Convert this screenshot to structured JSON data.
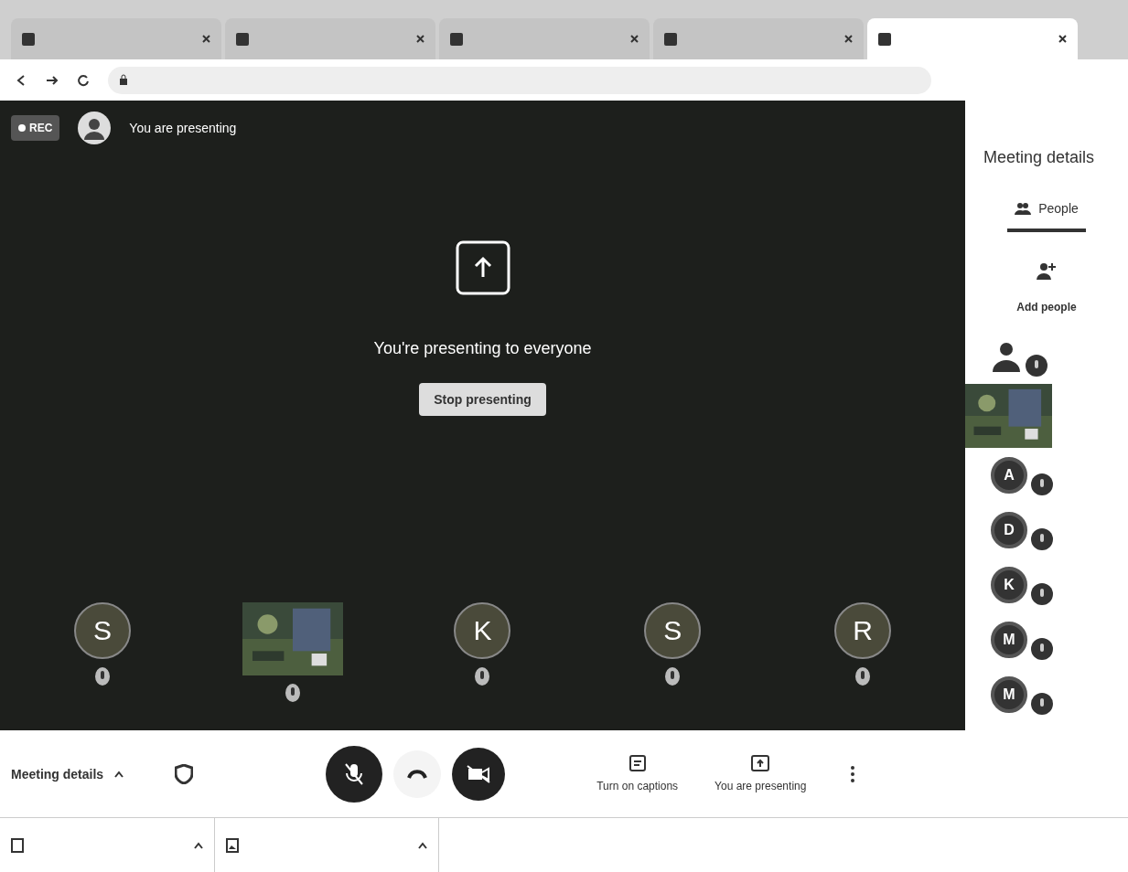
{
  "browser": {
    "tabs": [
      {
        "selected": false
      },
      {
        "selected": false
      },
      {
        "selected": false
      },
      {
        "selected": false
      },
      {
        "selected": true
      }
    ]
  },
  "meeting": {
    "rec_label": "REC",
    "presenter_note": "You are presenting",
    "message": "You're presenting to everyone",
    "stop_button": "Stop presenting",
    "tiles": [
      {
        "kind": "avatar",
        "initial": "S"
      },
      {
        "kind": "picture"
      },
      {
        "kind": "avatar",
        "initial": "K"
      },
      {
        "kind": "avatar",
        "initial": "S"
      },
      {
        "kind": "avatar",
        "initial": "R"
      }
    ]
  },
  "sidebar": {
    "title": "Meeting details",
    "tab": "People",
    "add_label": "Add people",
    "participants": [
      {
        "kind": "person"
      },
      {
        "kind": "picture"
      },
      {
        "kind": "avatar",
        "initial": "A"
      },
      {
        "kind": "avatar",
        "initial": "D"
      },
      {
        "kind": "avatar",
        "initial": "K"
      },
      {
        "kind": "avatar",
        "initial": "M"
      },
      {
        "kind": "avatar",
        "initial": "M"
      }
    ]
  },
  "controls": {
    "details_label": "Meeting details",
    "captions_label": "Turn on captions",
    "presenting_label": "You are presenting"
  }
}
